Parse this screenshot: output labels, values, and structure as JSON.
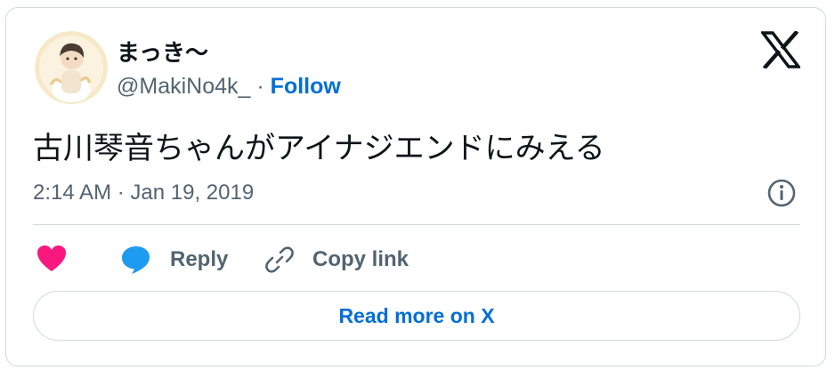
{
  "user": {
    "display_name": "まっき〜",
    "handle": "@MakiNo4k_",
    "separator": "·",
    "follow_label": "Follow",
    "avatar_icon": "user-avatar"
  },
  "tweet": {
    "text": "古川琴音ちゃんがアイナジエンドにみえる",
    "timestamp": "2:14 AM · Jan 19, 2019"
  },
  "actions": {
    "like_icon": "heart-icon",
    "reply_label": "Reply",
    "copy_label": "Copy link"
  },
  "footer": {
    "read_more_label": "Read more on X"
  },
  "colors": {
    "accent": "#006fd6",
    "like": "#f91880",
    "reply_icon": "#1d9bf0",
    "text_secondary": "#536471",
    "border": "#cfd9de"
  }
}
